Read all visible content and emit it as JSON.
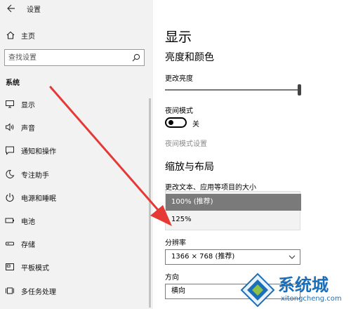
{
  "window": {
    "title": "设置"
  },
  "left": {
    "home_label": "主页",
    "search_placeholder": "查找设置",
    "section_label": "系统",
    "items": [
      {
        "label": "显示",
        "icon": "monitor-icon"
      },
      {
        "label": "声音",
        "icon": "speaker-icon"
      },
      {
        "label": "通知和操作",
        "icon": "notification-icon"
      },
      {
        "label": "专注助手",
        "icon": "moon-icon"
      },
      {
        "label": "电源和睡眠",
        "icon": "power-icon"
      },
      {
        "label": "电池",
        "icon": "battery-icon"
      },
      {
        "label": "存储",
        "icon": "storage-icon"
      },
      {
        "label": "平板模式",
        "icon": "tablet-icon"
      },
      {
        "label": "多任务处理",
        "icon": "multitask-icon"
      }
    ]
  },
  "right": {
    "title": "显示",
    "brightness_heading": "亮度和颜色",
    "brightness_label": "更改亮度",
    "brightness_value": 1.0,
    "night_mode_label": "夜间模式",
    "night_mode_state": "关",
    "night_mode_settings_link": "夜间模式设置",
    "scale_heading": "缩放与布局",
    "scale_label": "更改文本、应用等项目的大小",
    "scale_options": [
      "100% (推荐)",
      "125%"
    ],
    "scale_selected": "100% (推荐)",
    "resolution_label": "分辨率",
    "resolution_value": "1366 × 768 (推荐)",
    "orientation_label": "方向",
    "orientation_value": "横向"
  },
  "annotation": {
    "arrow_color": "#e53935"
  },
  "watermark": {
    "text": "系统城",
    "subtext": "xitongcheng.com",
    "color": "#1b6fb8"
  }
}
